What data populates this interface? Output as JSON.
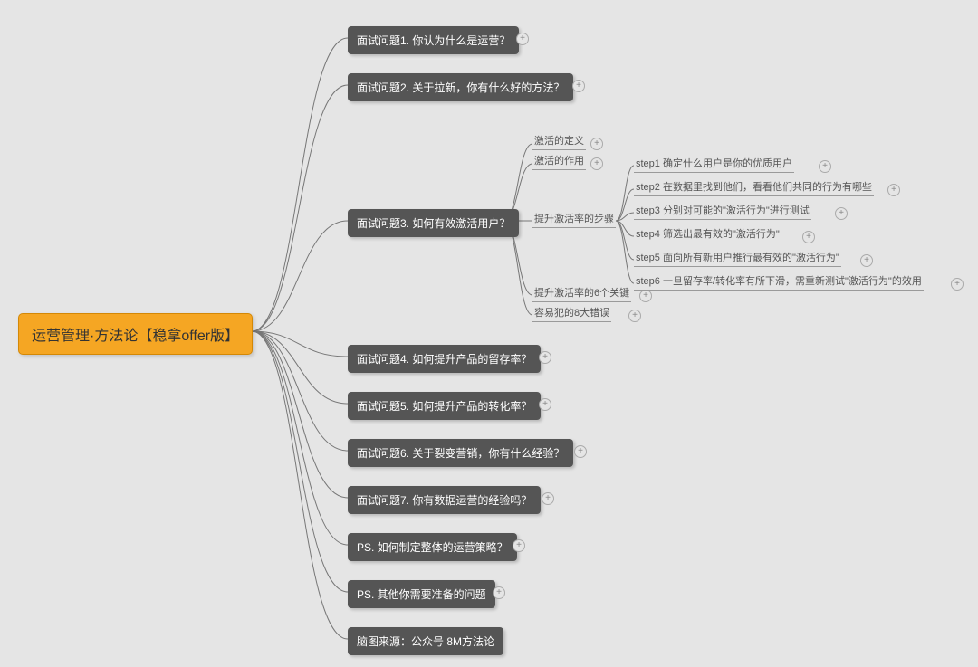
{
  "root": {
    "label": "运营管理·方法论【稳拿offer版】"
  },
  "level1": [
    {
      "label": "面试问题1. 你认为什么是运营？"
    },
    {
      "label": "面试问题2. 关于拉新，你有什么好的方法？"
    },
    {
      "label": "面试问题3. 如何有效激活用户？"
    },
    {
      "label": "面试问题4. 如何提升产品的留存率？"
    },
    {
      "label": "面试问题5. 如何提升产品的转化率？"
    },
    {
      "label": "面试问题6. 关于裂变营销，你有什么经验？"
    },
    {
      "label": "面试问题7. 你有数据运营的经验吗？"
    },
    {
      "label": "PS. 如何制定整体的运营策略？"
    },
    {
      "label": "PS. 其他你需要准备的问题"
    },
    {
      "label": "脑图来源：公众号 8M方法论"
    }
  ],
  "q3_children": [
    {
      "label": "激活的定义"
    },
    {
      "label": "激活的作用"
    },
    {
      "label": "提升激活率的步骤"
    },
    {
      "label": "提升激活率的6个关键"
    },
    {
      "label": "容易犯的8大错误"
    }
  ],
  "steps": [
    {
      "label": "step1 确定什么用户是你的优质用户"
    },
    {
      "label": "step2 在数据里找到他们，看看他们共同的行为有哪些"
    },
    {
      "label": "step3 分别对可能的\"激活行为\"进行测试"
    },
    {
      "label": "step4 筛选出最有效的\"激活行为\""
    },
    {
      "label": "step5 面向所有新用户推行最有效的\"激活行为\""
    },
    {
      "label": "step6 一旦留存率/转化率有所下滑，需重新测试\"激活行为\"的效用"
    }
  ]
}
